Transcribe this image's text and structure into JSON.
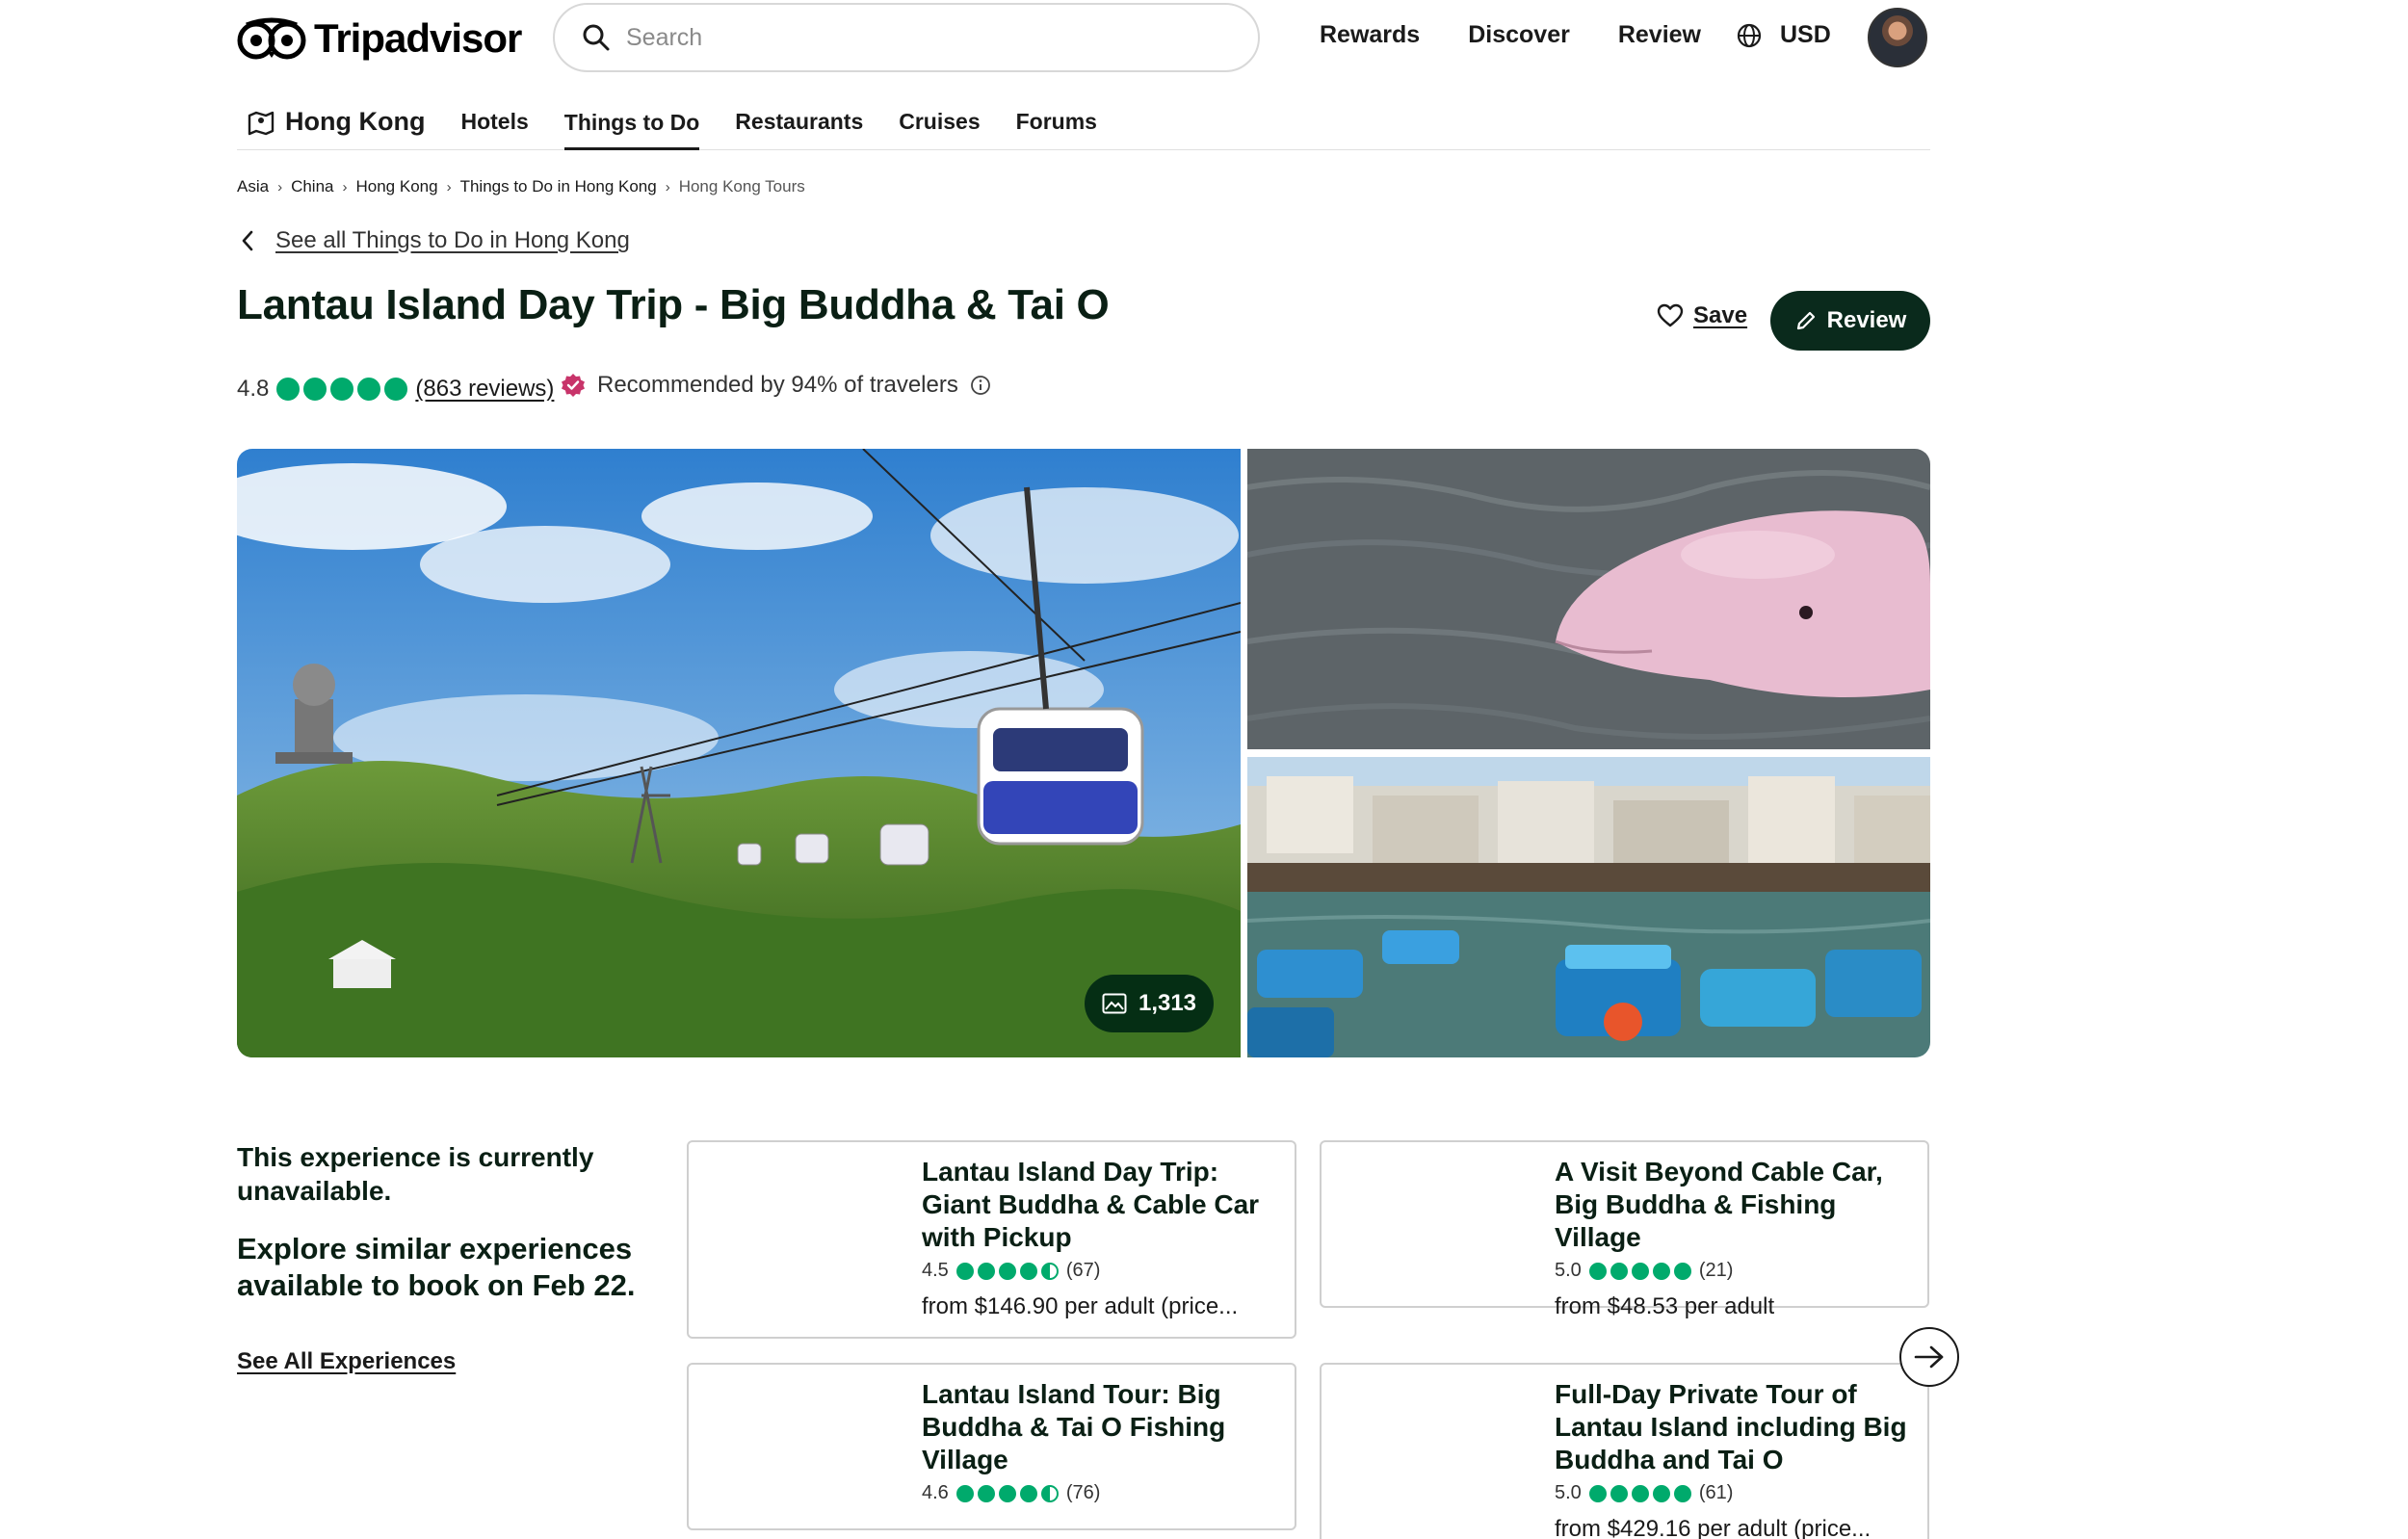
{
  "header": {
    "logo_text": "Tripadvisor",
    "search_placeholder": "Search",
    "nav": [
      "Rewards",
      "Discover",
      "Review"
    ],
    "currency": "USD"
  },
  "subnav": {
    "city": "Hong Kong",
    "items": [
      "Hotels",
      "Things to Do",
      "Restaurants",
      "Cruises",
      "Forums"
    ],
    "active": "Things to Do"
  },
  "breadcrumb": [
    "Asia",
    "China",
    "Hong Kong",
    "Things to Do in Hong Kong",
    "Hong Kong Tours"
  ],
  "back_link": "See all Things to Do in Hong Kong",
  "listing": {
    "title": "Lantau Island Day Trip - Big Buddha & Tai O",
    "save_label": "Save",
    "review_label": "Review",
    "rating": "4.8",
    "rating_bubbles": 5,
    "reviews_text": "(863 reviews)",
    "recommended": "Recommended by 94% of travelers",
    "photo_count": "1,313"
  },
  "unavailable": {
    "message": "This experience is currently unavailable.",
    "explore": "Explore similar experiences available to book on Feb 22.",
    "see_all": "See All Experiences"
  },
  "cards": [
    {
      "title": "Lantau Island Day Trip: Giant Buddha & Cable Car with Pickup",
      "rating": "4.5",
      "bubbles": 4.5,
      "count": "(67)",
      "price": "from $146.90 per adult (price..."
    },
    {
      "title": "A Visit Beyond Cable Car, Big Buddha & Fishing Village",
      "rating": "5.0",
      "bubbles": 5,
      "count": "(21)",
      "price": "from $48.53 per adult"
    },
    {
      "title": "Lantau Island Tour: Big Buddha & Tai O Fishing Village",
      "rating": "4.6",
      "bubbles": 4.5,
      "count": "(76)",
      "price": ""
    },
    {
      "title": "Full-Day Private Tour of Lantau Island including Big Buddha and Tai O",
      "rating": "5.0",
      "bubbles": 5,
      "count": "(61)",
      "price": "from $429.16 per adult (price..."
    }
  ],
  "colors": {
    "brand_dark": "#0a2a1c",
    "rating_green": "#00aa6c",
    "recommend_badge": "#c8346a"
  }
}
